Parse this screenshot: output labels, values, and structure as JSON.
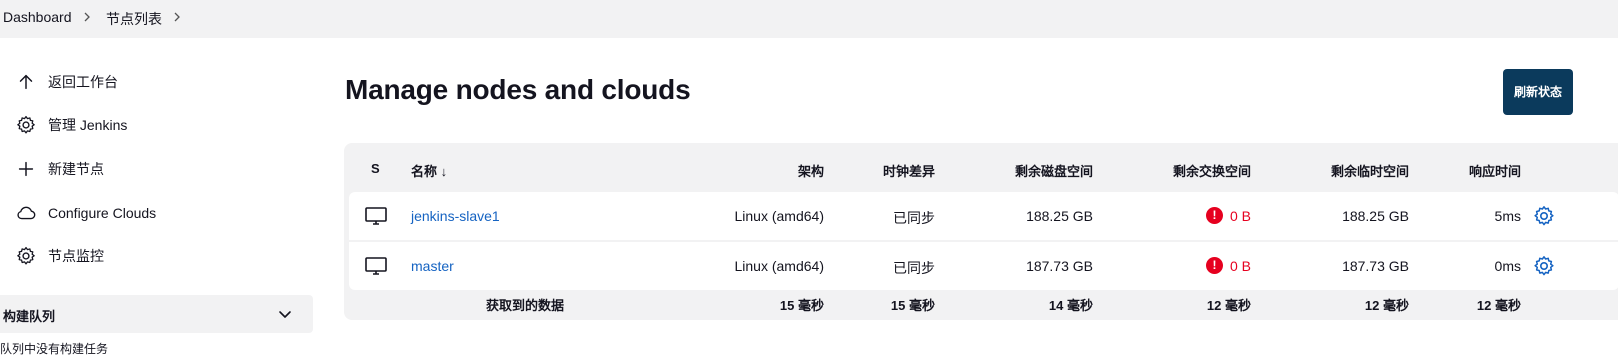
{
  "breadcrumb": {
    "items": [
      "Dashboard",
      "节点列表"
    ]
  },
  "sidebar": {
    "items": [
      {
        "label": "返回工作台",
        "icon": "arrow-up-icon"
      },
      {
        "label": "管理 Jenkins",
        "icon": "gear-icon"
      },
      {
        "label": "新建节点",
        "icon": "plus-icon"
      },
      {
        "label": "Configure Clouds",
        "icon": "cloud-icon"
      },
      {
        "label": "节点监控",
        "icon": "gear-icon"
      }
    ],
    "queue": {
      "title": "构建队列",
      "empty_text": "队列中没有构建任务"
    }
  },
  "main": {
    "title": "Manage nodes and clouds",
    "refresh_label": "刷新状态"
  },
  "table": {
    "headers": {
      "status": "S",
      "name": "名称 ↓",
      "arch": "架构",
      "clock": "时钟差异",
      "disk": "剩余磁盘空间",
      "swap": "剩余交换空间",
      "temp": "剩余临时空间",
      "response": "响应时间"
    },
    "rows": [
      {
        "name": "jenkins-slave1",
        "arch": "Linux (amd64)",
        "clock": "已同步",
        "disk": "188.25 GB",
        "swap": "0 B",
        "temp": "188.25 GB",
        "response": "5ms"
      },
      {
        "name": "master",
        "arch": "Linux (amd64)",
        "clock": "已同步",
        "disk": "187.73 GB",
        "swap": "0 B",
        "temp": "187.73 GB",
        "response": "0ms"
      }
    ],
    "footer": {
      "label": "获取到的数据",
      "arch": "15 毫秒",
      "clock": "15 毫秒",
      "disk": "14 毫秒",
      "swap": "12 毫秒",
      "temp": "12 毫秒",
      "response": "12 毫秒"
    }
  },
  "colors": {
    "accent": "#0b3a5c",
    "link": "#1563c2",
    "warning": "#e6001f"
  }
}
